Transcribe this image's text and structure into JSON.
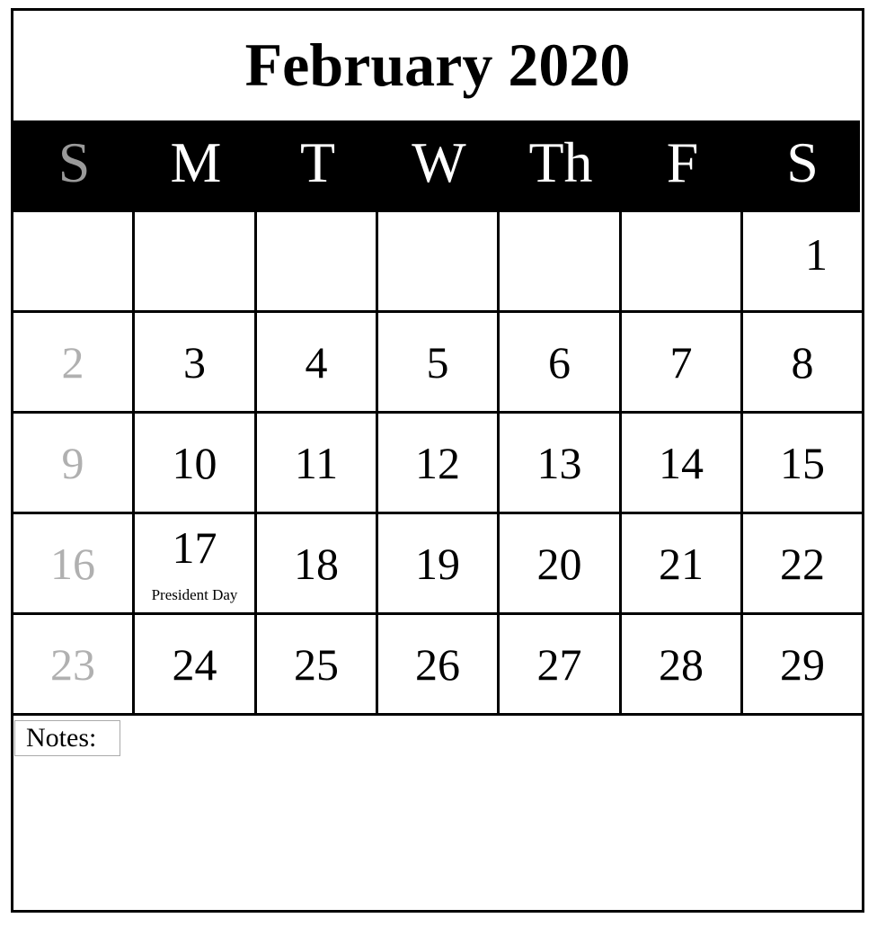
{
  "title": "February 2020",
  "weekdays": [
    {
      "label": "S",
      "weekend": true
    },
    {
      "label": "M"
    },
    {
      "label": "T"
    },
    {
      "label": "W"
    },
    {
      "label": "Th"
    },
    {
      "label": "F"
    },
    {
      "label": "S"
    }
  ],
  "weeks": [
    [
      "",
      "",
      "",
      "",
      "",
      "",
      "1"
    ],
    [
      "2",
      "3",
      "4",
      "5",
      "6",
      "7",
      "8"
    ],
    [
      "9",
      "10",
      "11",
      "12",
      "13",
      "14",
      "15"
    ],
    [
      "16",
      "17",
      "18",
      "19",
      "20",
      "21",
      "22"
    ],
    [
      "23",
      "24",
      "25",
      "26",
      "27",
      "28",
      "29"
    ]
  ],
  "events": {
    "17": "President Day"
  },
  "notes_label": "Notes:",
  "colors": {
    "header_bg": "#000000",
    "header_text": "#ffffff",
    "sunday_header": "#9a9a9a",
    "sunday_dates": "#b0b0b0"
  }
}
